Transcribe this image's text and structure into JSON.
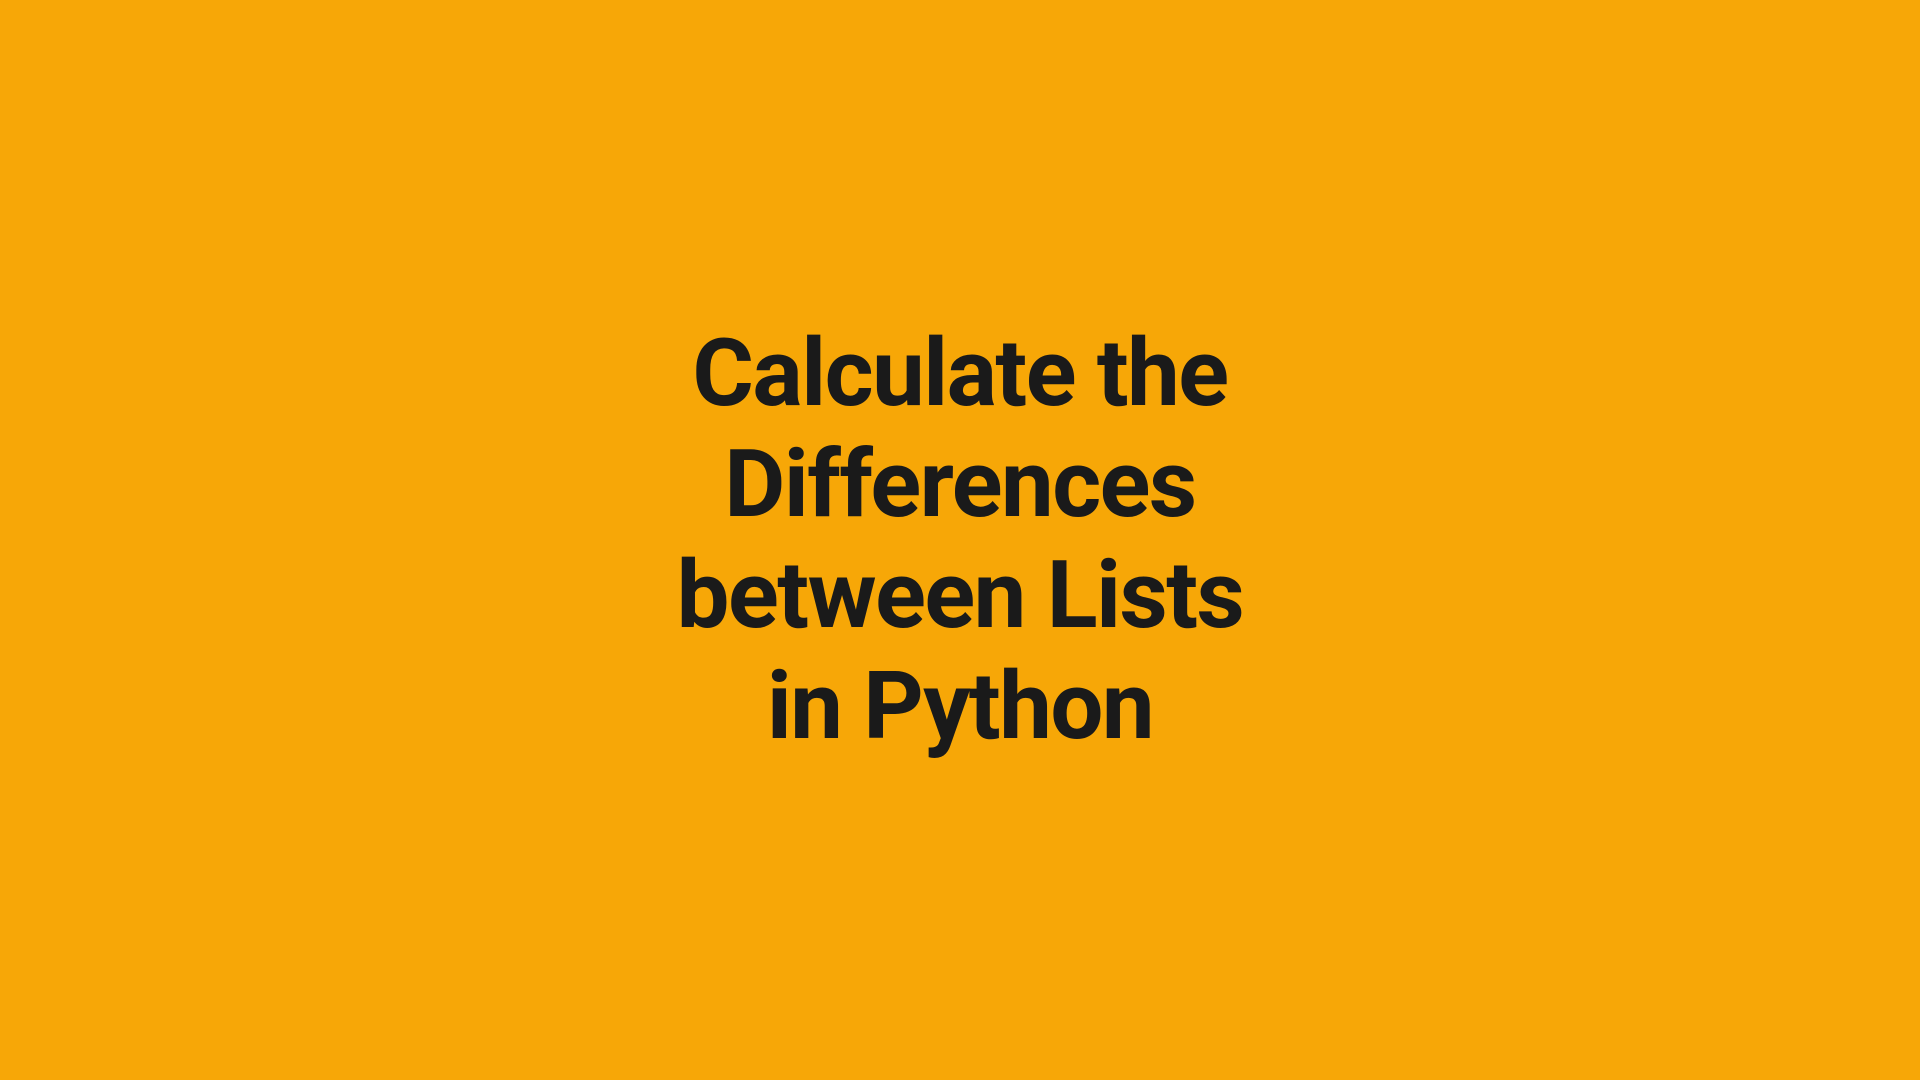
{
  "title": {
    "line1": "Calculate the",
    "line2": "Differences",
    "line3": "between Lists",
    "line4": "in Python"
  },
  "colors": {
    "background": "#F7A707",
    "text": "#1a1a1a"
  }
}
